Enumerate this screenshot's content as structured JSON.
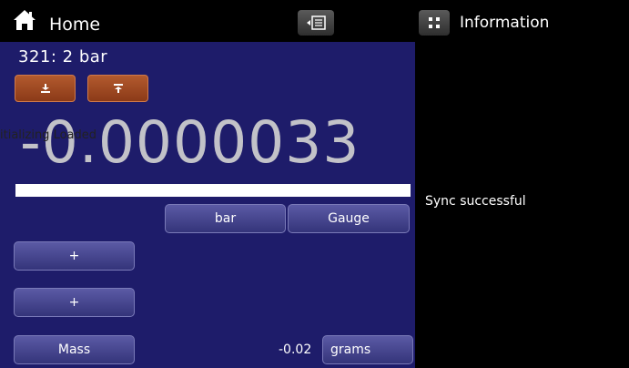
{
  "header": {
    "title": "Home",
    "home_icon": "home-icon",
    "menu_icon": "menu-toggle-icon",
    "info_icon": "grid-icon"
  },
  "info_panel": {
    "title": "Information",
    "status": "Sync successful"
  },
  "main": {
    "channel": "321:  2 bar",
    "tare_down_icon": "download-icon",
    "tare_up_icon": "upload-icon",
    "overlay_text": "itializing Loaded",
    "reading": "-0.0000033",
    "unit_label": "bar",
    "mode_label": "Gauge",
    "plus_label_1": "+",
    "plus_label_2": "+",
    "mass_label": "Mass",
    "mass_value": "-0.02",
    "mass_unit": "grams"
  },
  "colors": {
    "panel": "#1e1c6a",
    "button": "#4a4a95",
    "accent_button": "#a04a22",
    "reading": "#c2c2c8"
  }
}
